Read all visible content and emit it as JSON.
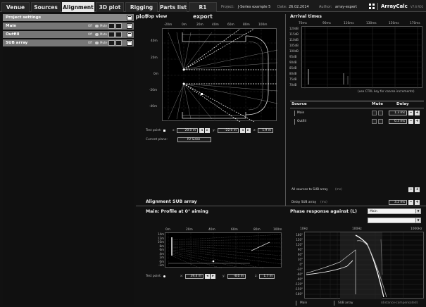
{
  "tabs": [
    {
      "label": "Venue",
      "active": false
    },
    {
      "label": "Sources",
      "active": false
    },
    {
      "label": "Alignment",
      "active": true
    },
    {
      "label": "3D plot",
      "active": false
    },
    {
      "label": "Rigging plot",
      "active": false
    },
    {
      "label": "Parts list",
      "active": false
    },
    {
      "label": "R1 export",
      "active": false
    }
  ],
  "header": {
    "project_label": "Project:",
    "project_value": "J-Series example 5",
    "date_label": "Date:",
    "date_value": "26.02.2014",
    "author_label": "Author:",
    "author_value": "array-expert",
    "app_name": "ArrayCalc",
    "version": "V7.6 R01"
  },
  "left_panel": {
    "project_settings": "Project settings",
    "groups": [
      {
        "label": "Main",
        "off": "Off",
        "mute": "Mute"
      },
      {
        "label": "Outfill",
        "off": "Off",
        "mute": "Mute"
      },
      {
        "label": "SUB array",
        "off": "Off",
        "mute": "Mute"
      }
    ]
  },
  "top_view": {
    "title": "Top view",
    "x_ticks": [
      "-20m",
      "0m",
      "20m",
      "40m",
      "60m",
      "80m",
      "100m"
    ],
    "y_ticks": [
      "40m",
      "20m",
      "0m",
      "-20m",
      "-40m"
    ],
    "test_point_label": "Test point:",
    "x_label": "x:",
    "x_value": "20.0 m",
    "y_label": "y:",
    "y_value": "-22.0 m",
    "z_label": "z:",
    "z_value": "1.9 m",
    "current_plane_label": "Current plane:",
    "current_plane_value": "P2 Sides"
  },
  "arrival_times": {
    "title": "Arrival times",
    "x_ticks": [
      "70ms",
      "90ms",
      "110ms",
      "130ms",
      "150ms",
      "170ms"
    ],
    "y_ticks": [
      "120dB",
      "115dB",
      "110dB",
      "105dB",
      "100dB",
      "95dB",
      "90dB",
      "85dB",
      "80dB",
      "75dB",
      "70dB"
    ],
    "hint": "(use CTRL key for coarse increments)"
  },
  "source_table": {
    "col_source": "Source",
    "col_mute": "Mute",
    "col_delay": "Delay",
    "rows": [
      {
        "name": "Main",
        "delay": "1.3 ms"
      },
      {
        "name": "Outfill",
        "delay": "0.3 ms"
      }
    ],
    "all_sources_label": "All sources to SUB array",
    "all_sources_unit": "(ms)",
    "delay_sub_label": "Delay SUB array",
    "delay_sub_unit": "(ms)",
    "delay_sub_value": "3.2 ms"
  },
  "alignment_sub": {
    "title": "Alignment SUB array"
  },
  "profile": {
    "title": "Main: Profile at 0° aiming",
    "x_ticks": [
      "0m",
      "20m",
      "40m",
      "60m",
      "80m",
      "100m"
    ],
    "y_ticks": [
      "14m",
      "12m",
      "10m",
      "8m",
      "6m",
      "4m",
      "2m",
      "0m",
      "-2m"
    ],
    "test_point_label": "Test point:",
    "x_label": "x:",
    "x_value": "39.4 m",
    "y_label": "y:",
    "y_value": "-8.0 m",
    "z_label": "z:",
    "z_value": "1.7 m"
  },
  "phase": {
    "title": "Phase response against (L)",
    "select_value": "Main",
    "select2_value": "",
    "x_ticks": [
      "10Hz",
      "100Hz",
      "1000Hz"
    ],
    "y_ticks": [
      "180°",
      "150°",
      "120°",
      "90°",
      "60°",
      "30°",
      "0°",
      "-30°",
      "-60°",
      "-90°",
      "-120°",
      "-150°",
      "-180°"
    ],
    "legend_main": "Main",
    "legend_sub": "SUB array",
    "note": "(distance-compensated)"
  },
  "colors": {
    "background": "#111111",
    "plot_background": "#000000",
    "panel_row": "#777777",
    "active_tab": "#e8e8e8"
  }
}
